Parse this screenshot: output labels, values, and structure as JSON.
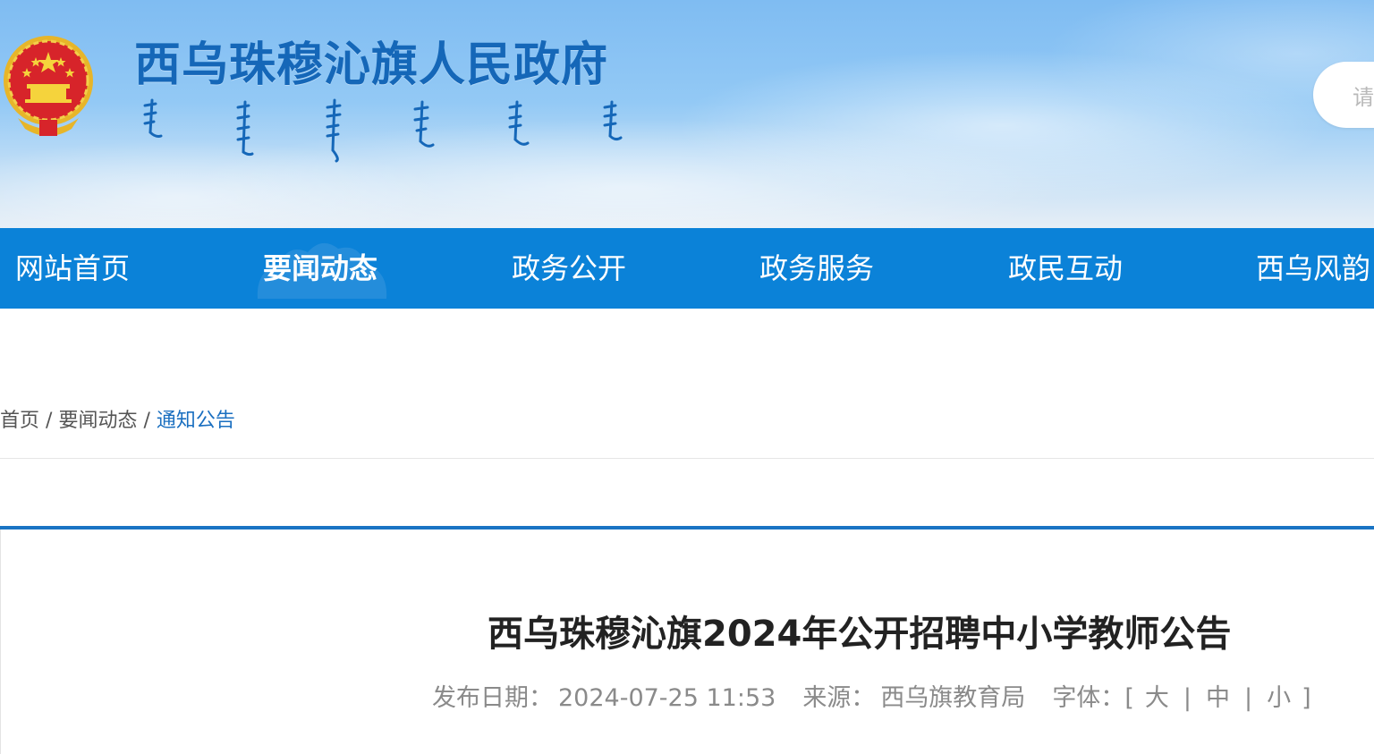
{
  "header": {
    "site_title": "西乌珠穆沁旗人民政府",
    "emblem_icon": "national-emblem-icon",
    "search_placeholder": "请"
  },
  "nav": {
    "items": [
      {
        "label": "网站首页",
        "active": false
      },
      {
        "label": "要闻动态",
        "active": true
      },
      {
        "label": "政务公开",
        "active": false
      },
      {
        "label": "政务服务",
        "active": false
      },
      {
        "label": "政民互动",
        "active": false
      },
      {
        "label": "西乌风韵",
        "active": false
      }
    ]
  },
  "breadcrumb": {
    "items": [
      "首页",
      "要闻动态",
      "通知公告"
    ],
    "separator": "/"
  },
  "article": {
    "title": "西乌珠穆沁旗2024年公开招聘中小学教师公告",
    "publish_label": "发布日期：",
    "publish_value": "2024-07-25 11:53",
    "source_label": "来源：",
    "source_value": "西乌旗教育局",
    "font_label": "字体：",
    "font_open": "[",
    "font_close": "]",
    "font_sizes": [
      "大",
      "中",
      "小"
    ],
    "font_sep": "|"
  },
  "colors": {
    "nav_bg": "#0b82d8",
    "title_blue": "#1567b8",
    "accent_line": "#1a74c4",
    "breadcrumb_current": "#1a6fc0"
  }
}
